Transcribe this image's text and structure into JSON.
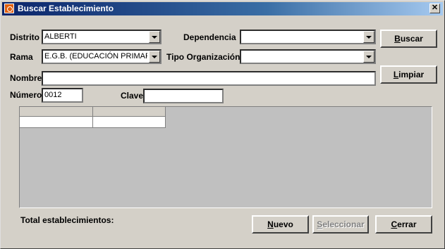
{
  "window": {
    "title": "Buscar Establecimiento",
    "close_glyph": "✕"
  },
  "form": {
    "distrito": {
      "label": "Distrito",
      "value": "ALBERTI"
    },
    "dependencia": {
      "label": "Dependencia",
      "value": ""
    },
    "rama": {
      "label": "Rama",
      "value": "E.G.B. (EDUCACIÓN PRIMARIA"
    },
    "tipo_organizacion": {
      "label": "Tipo Organización",
      "value": ""
    },
    "nombre": {
      "label": "Nombre",
      "value": ""
    },
    "numero": {
      "label": "Número",
      "value": "0012"
    },
    "clave": {
      "label": "Clave",
      "value": ""
    }
  },
  "buttons": {
    "buscar": {
      "mnemonic": "B",
      "rest": "uscar"
    },
    "limpiar": {
      "mnemonic": "L",
      "rest": "impiar"
    },
    "nuevo": {
      "mnemonic": "N",
      "rest": "uevo"
    },
    "seleccionar": {
      "mnemonic": "S",
      "rest": "eleccionar",
      "enabled": false
    },
    "cerrar": {
      "mnemonic": "C",
      "rest": "errar"
    }
  },
  "grid": {
    "columns": [
      "",
      ""
    ],
    "rows": [
      [
        "",
        ""
      ]
    ]
  },
  "footer": {
    "total_label": "Total establecimientos:"
  },
  "colors": {
    "face": "#d4d0c8",
    "title_start": "#0a246a",
    "title_end": "#a6caf0"
  }
}
